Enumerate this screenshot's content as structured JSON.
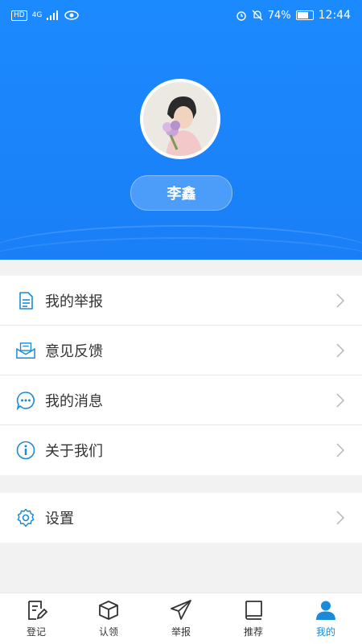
{
  "status": {
    "signal": "4G",
    "battery": "74%",
    "time": "12:44"
  },
  "profile": {
    "name": "李鑫"
  },
  "menu_groups": [
    {
      "items": [
        {
          "label": "我的举报",
          "icon": "document-icon"
        },
        {
          "label": "意见反馈",
          "icon": "envelope-icon"
        },
        {
          "label": "我的消息",
          "icon": "chat-bubble-icon"
        },
        {
          "label": "关于我们",
          "icon": "info-icon"
        }
      ]
    },
    {
      "items": [
        {
          "label": "设置",
          "icon": "gear-icon"
        }
      ]
    }
  ],
  "tabs": [
    {
      "label": "登记",
      "icon": "edit-icon",
      "active": false
    },
    {
      "label": "认领",
      "icon": "box-icon",
      "active": false
    },
    {
      "label": "举报",
      "icon": "paper-plane-icon",
      "active": false
    },
    {
      "label": "推荐",
      "icon": "book-icon",
      "active": false
    },
    {
      "label": "我的",
      "icon": "user-icon",
      "active": true
    }
  ],
  "colors": {
    "header": "#1a82fa",
    "accent": "#1a8bd8",
    "icon": "#1a8bd8"
  }
}
